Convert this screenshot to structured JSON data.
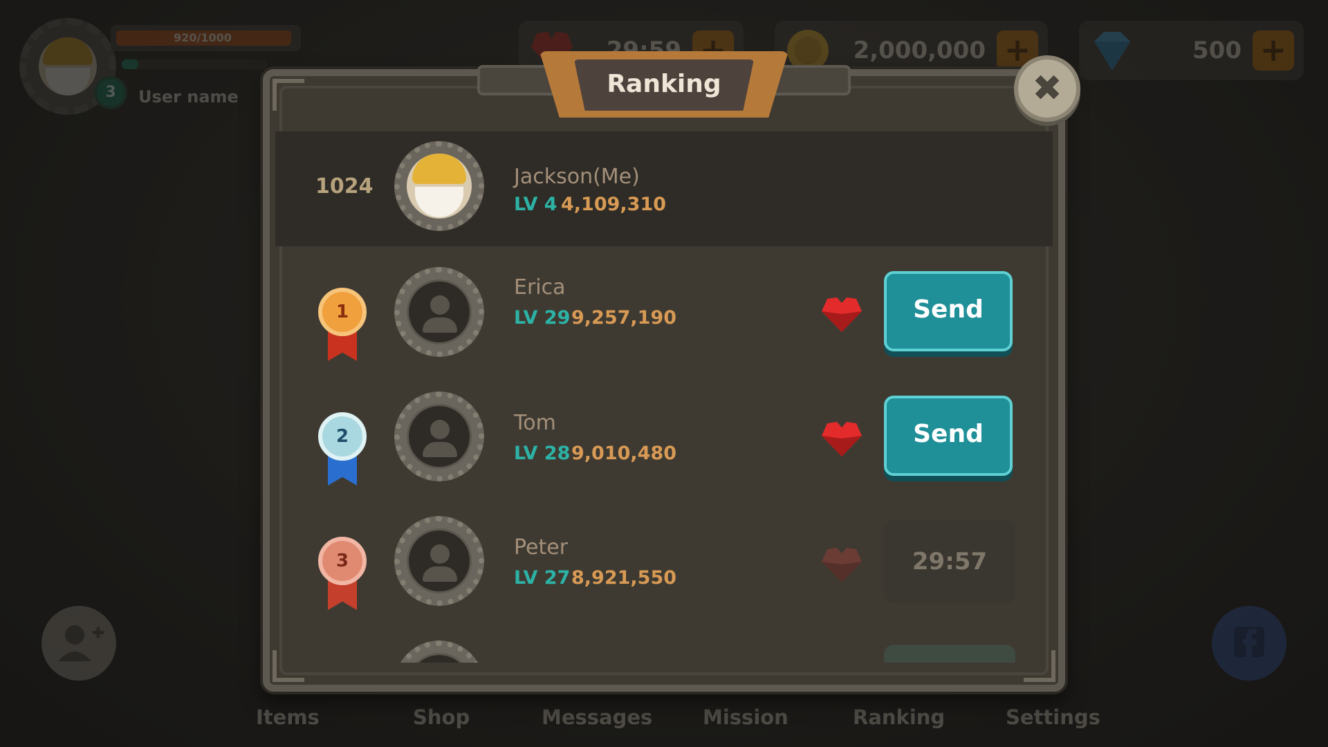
{
  "hud": {
    "xp_text": "920/1000",
    "xp_fraction": 0.92,
    "level": "3",
    "username": "User name",
    "hearts_timer": "29:59",
    "coins": "2,000,000",
    "gems": "500",
    "plus_label": "+"
  },
  "modal": {
    "title": "Ranking",
    "close_label": "✖"
  },
  "me": {
    "rank": "1024",
    "name": "Jackson(Me)",
    "level": "LV 4",
    "score": "4,109,310"
  },
  "players": [
    {
      "rank": "1",
      "name": "Erica",
      "level": "LV 29",
      "score": "9,257,190",
      "action": "Send",
      "medal": "gold"
    },
    {
      "rank": "2",
      "name": "Tom",
      "level": "LV 28",
      "score": "9,010,480",
      "action": "Send",
      "medal": "silver"
    },
    {
      "rank": "3",
      "name": "Peter",
      "level": "LV 27",
      "score": "8,921,550",
      "action": "29:57",
      "medal": "bronze"
    }
  ],
  "nav": {
    "items": [
      "Items",
      "Shop",
      "Messages",
      "Mission",
      "Ranking",
      "Settings"
    ]
  },
  "colors": {
    "send_button": "#1f8f98",
    "level_text": "#2cb3a6",
    "score_text": "#d89a54",
    "heart": "#e32b2b"
  }
}
